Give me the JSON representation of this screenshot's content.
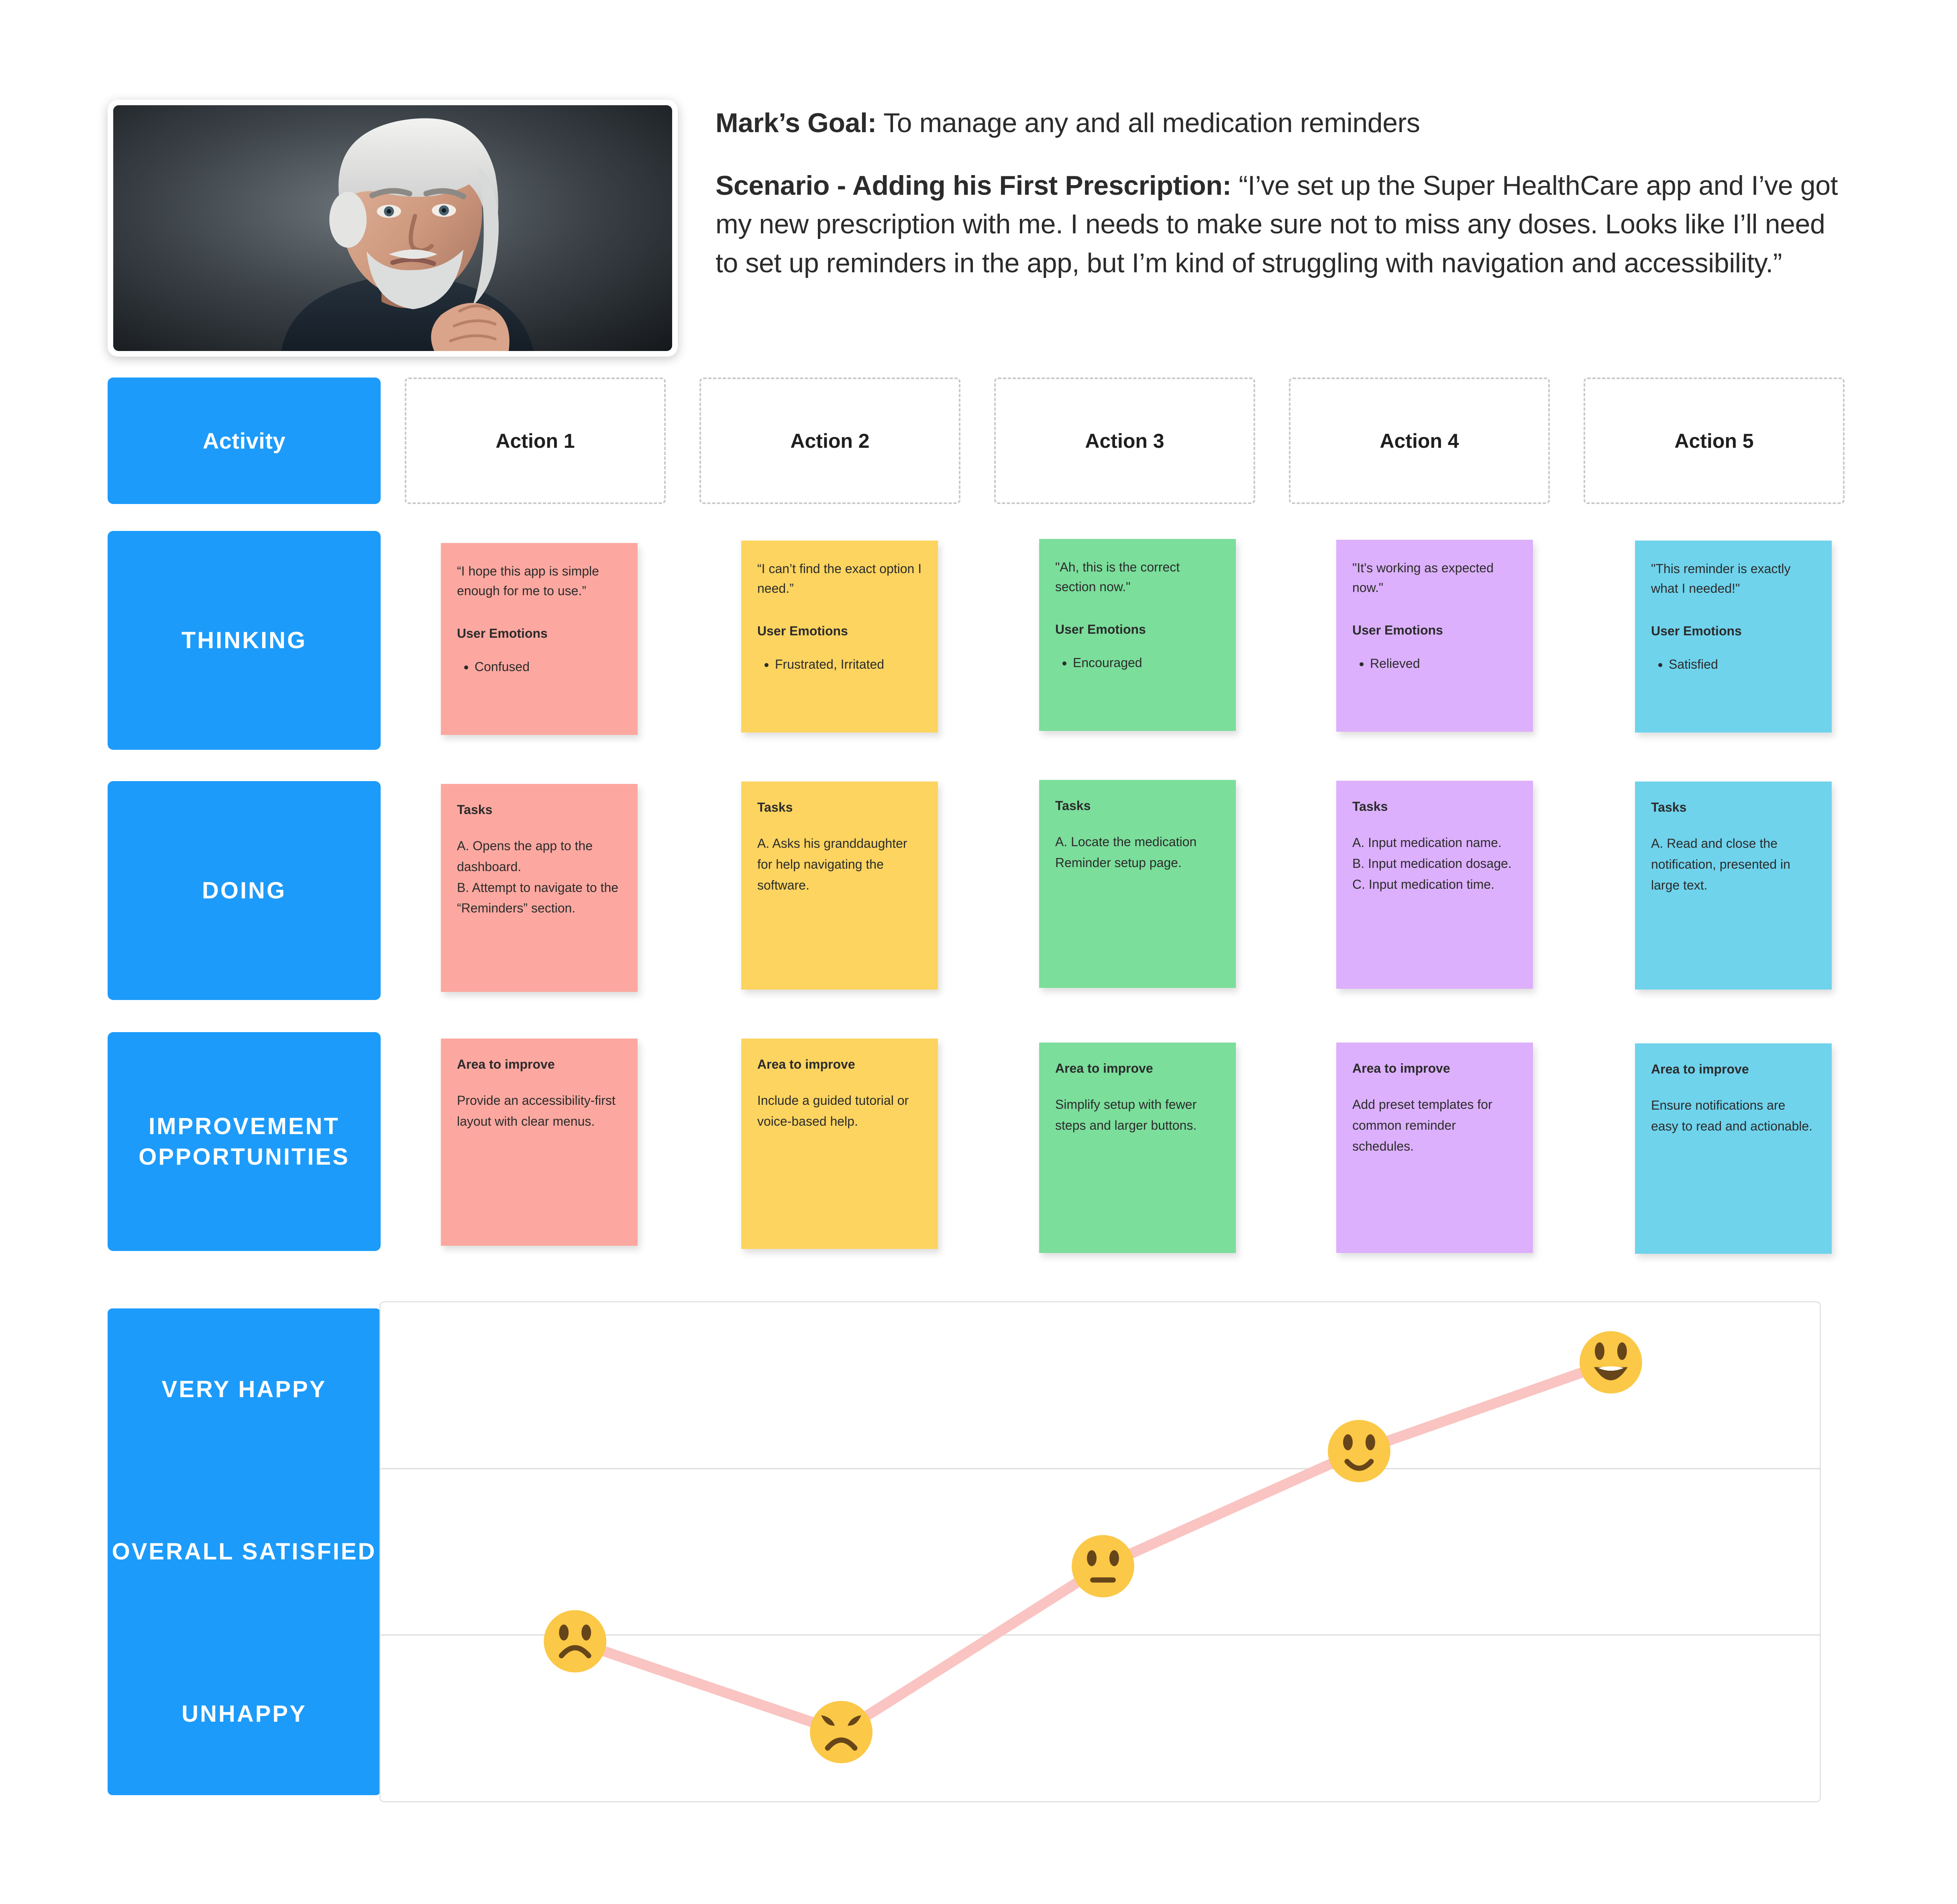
{
  "header": {
    "goal_label": "Mark’s Goal:",
    "goal_text": " To manage any and all medication reminders",
    "scenario_label": "Scenario - Adding his First Prescription:",
    "scenario_text": " “I’ve set up the Super HealthCare app and I’ve got my new prescription with me. I needs to make sure not to miss any doses. Looks like I’ll need to set up reminders in the app, but I’m kind of struggling with navigation and accessibility.”",
    "persona_photo_alt": "elderly-man-portrait"
  },
  "rows": {
    "activity": "Activity",
    "thinking": "THINKING",
    "doing": "DOING",
    "improvement": "IMPROVEMENT OPPORTUNITIES"
  },
  "actions": [
    {
      "label": "Action 1"
    },
    {
      "label": "Action 2"
    },
    {
      "label": "Action 3"
    },
    {
      "label": "Action 4"
    },
    {
      "label": "Action 5"
    }
  ],
  "colors": {
    "brand_blue": "#1c9bfb",
    "note_pink": "#FCA8A0",
    "note_yellow": "#FCD45F",
    "note_green": "#7BDE9B",
    "note_purple": "#DCB0FC",
    "note_cyan": "#6FD3EC",
    "chart_line": "#F9C4C1",
    "emoji_yellow": "#FBC847",
    "gridline": "#dcdcdc"
  },
  "thinking": [
    {
      "quote": "“I hope this app is simple enough for me to use.”",
      "sub_head": "User Emotions",
      "emotions": [
        "Confused"
      ],
      "color": "#FCA8A0"
    },
    {
      "quote": "“I can’t find the exact option I need.”",
      "sub_head": "User Emotions",
      "emotions": [
        "Frustrated, Irritated"
      ],
      "color": "#FCD45F"
    },
    {
      "quote": "\"Ah, this is the correct section now.\"",
      "sub_head": "User Emotions",
      "emotions": [
        "Encouraged"
      ],
      "color": "#7BDE9B"
    },
    {
      "quote": "\"It's working as expected now.\"",
      "sub_head": "User Emotions",
      "emotions": [
        "Relieved"
      ],
      "color": "#DCB0FC"
    },
    {
      "quote": "\"This reminder is exactly what I needed!\"",
      "sub_head": "User Emotions",
      "emotions": [
        "Satisfied"
      ],
      "color": "#6FD3EC"
    }
  ],
  "doing": [
    {
      "sub_head": "Tasks",
      "body": "A. Opens the app to the dashboard.\nB. Attempt to navigate to the “Reminders” section.",
      "color": "#FCA8A0"
    },
    {
      "sub_head": "Tasks",
      "body": "A. Asks his granddaughter for help navigating the software.",
      "color": "#FCD45F"
    },
    {
      "sub_head": "Tasks",
      "body": "A. Locate the medication Reminder setup page.",
      "color": "#7BDE9B"
    },
    {
      "sub_head": "Tasks",
      "body": "A. Input medication name.\nB. Input medication dosage.\nC. Input medication time.",
      "color": "#DCB0FC"
    },
    {
      "sub_head": "Tasks",
      "body": "A. Read and close the notification, presented in large text.",
      "color": "#6FD3EC"
    }
  ],
  "improvement": [
    {
      "sub_head": "Area to improve",
      "body": "Provide an accessibility-first layout with clear menus.",
      "color": "#FCA8A0"
    },
    {
      "sub_head": "Area to improve",
      "body": "Include a guided tutorial or voice-based help.",
      "color": "#FCD45F"
    },
    {
      "sub_head": "Area to improve",
      "body": "Simplify setup with fewer steps and larger buttons.",
      "color": "#7BDE9B"
    },
    {
      "sub_head": "Area to improve",
      "body": "Add preset templates for common reminder schedules.",
      "color": "#DCB0FC"
    },
    {
      "sub_head": "Area to improve",
      "body": "Ensure notifications are easy to read and actionable.",
      "color": "#6FD3EC"
    }
  ],
  "chart_data": {
    "type": "line",
    "title": "",
    "xlabel": "",
    "ylabel": "",
    "categories": [
      "Action 1",
      "Action 2",
      "Action 3",
      "Action 4",
      "Action 5"
    ],
    "y_levels": [
      "VERY HAPPY",
      "OVERALL SATISFIED",
      "UNHAPPY"
    ],
    "grid": true,
    "legend": "none",
    "values": [
      2.4,
      1.6,
      4.0,
      5.2,
      6.3
    ],
    "ylim": [
      0,
      7
    ],
    "points": [
      {
        "action": "Action 1",
        "emoji": "frowning-face",
        "level": "between UNHAPPY and OVERALL SATISFIED",
        "x_pct": 13.5,
        "y_pct": 68
      },
      {
        "action": "Action 2",
        "emoji": "angry-face",
        "level": "UNHAPPY",
        "x_pct": 32.0,
        "y_pct": 86
      },
      {
        "action": "Action 3",
        "emoji": "neutral-face",
        "level": "OVERALL SATISFIED",
        "x_pct": 50.2,
        "y_pct": 53
      },
      {
        "action": "Action 4",
        "emoji": "slightly-smiling-face",
        "level": "between OVERALL SATISFIED and VERY HAPPY",
        "x_pct": 68.0,
        "y_pct": 30
      },
      {
        "action": "Action 5",
        "emoji": "grinning-face",
        "level": "VERY HAPPY",
        "x_pct": 85.5,
        "y_pct": 12
      }
    ]
  }
}
